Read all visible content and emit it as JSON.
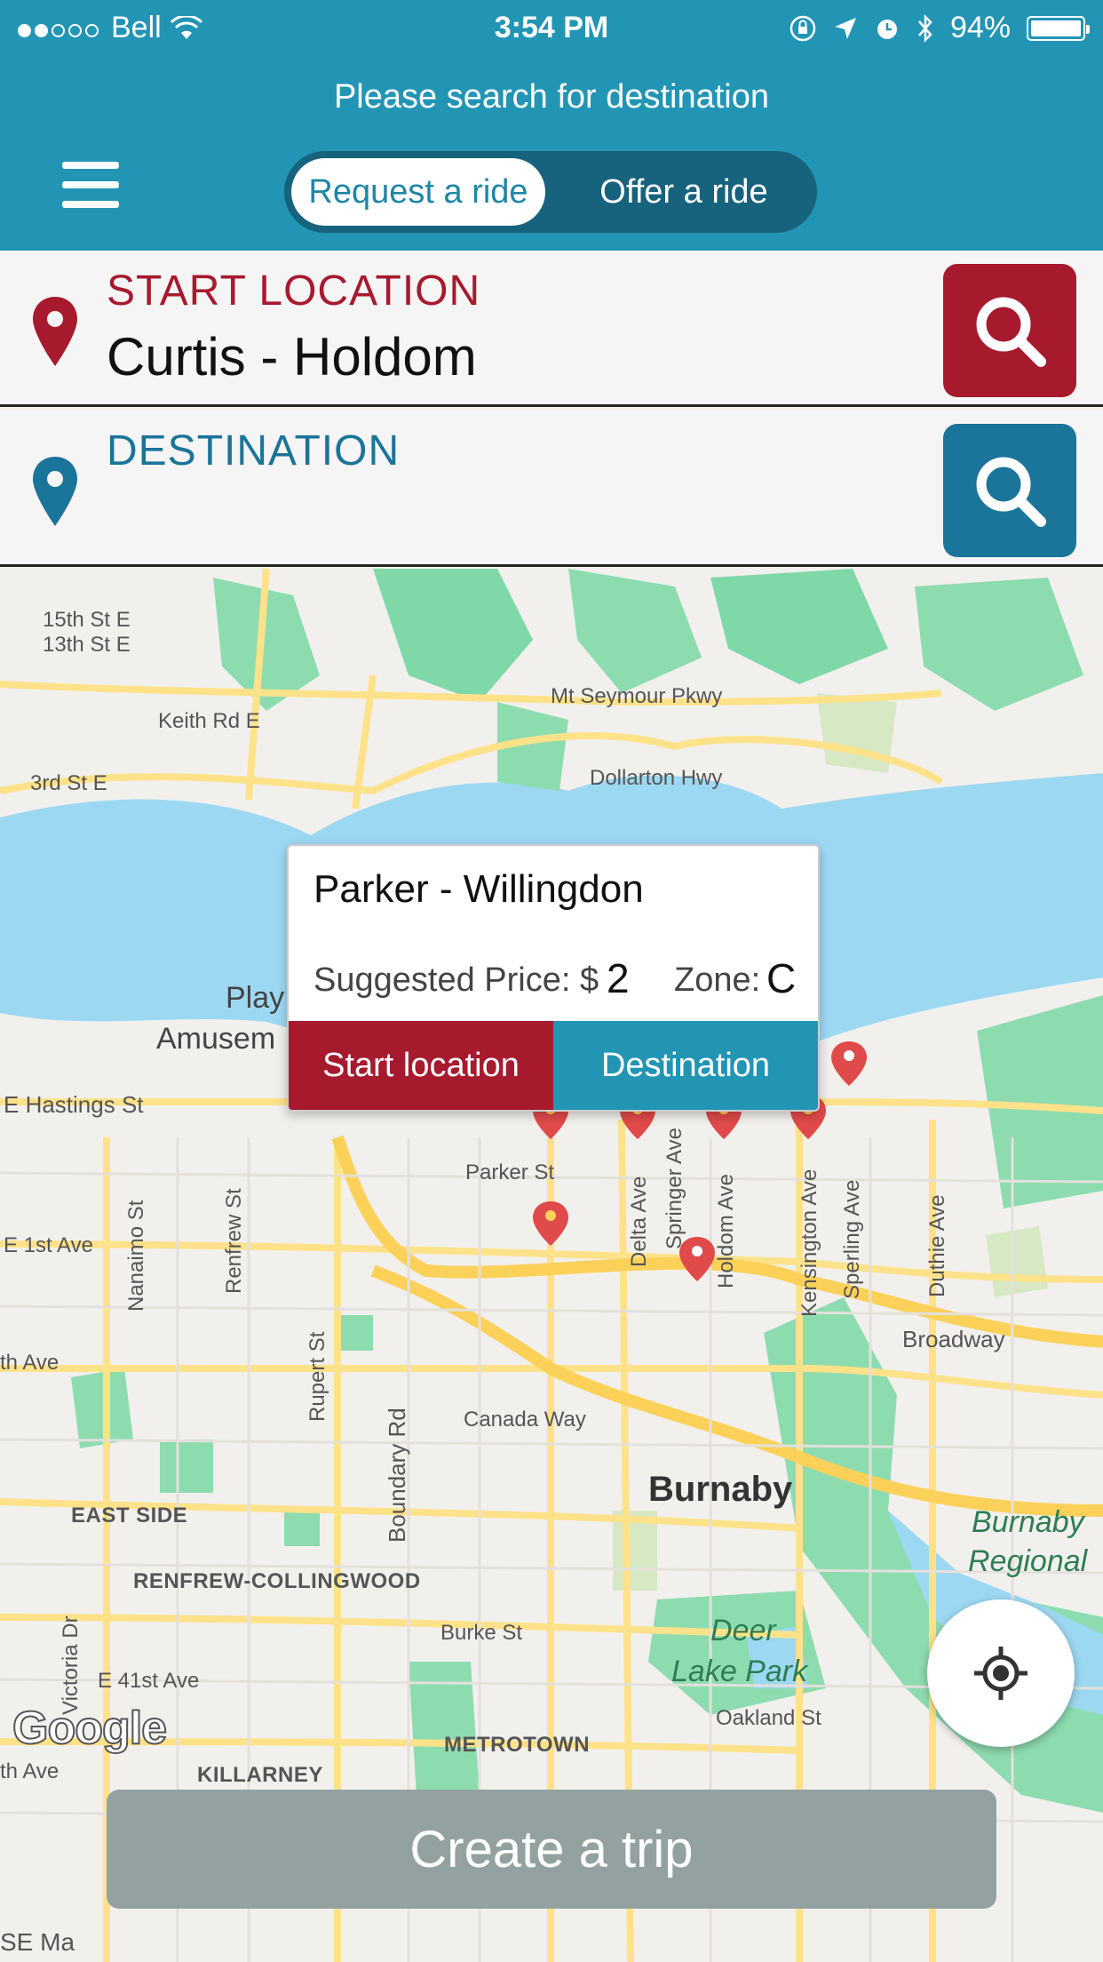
{
  "status_bar": {
    "carrier": "Bell",
    "time": "3:54 PM",
    "battery": "94%",
    "signal_bars_filled": 2,
    "signal_bars_total": 5
  },
  "header": {
    "subtitle": "Please search for destination",
    "segment": {
      "request_label": "Request a ride",
      "offer_label": "Offer a ride",
      "selected": "Request a ride"
    }
  },
  "start": {
    "label": "START LOCATION",
    "value": "Curtis - Holdom"
  },
  "destination": {
    "label": "DESTINATION",
    "value": ""
  },
  "popup": {
    "title": "Parker - Willingdon",
    "price_label": "Suggested Price: $",
    "price_value": "2",
    "zone_label": "Zone:",
    "zone_value": "C",
    "start_button": "Start location",
    "destination_button": "Destination"
  },
  "map": {
    "labels": {
      "st15": "15th St E",
      "st13": "13th St E",
      "keith": "Keith Rd E",
      "st3": "3rd St E",
      "seymour": "Mt Seymour Pkwy",
      "dollarton": "Dollarton Hwy",
      "play": "Play",
      "amusem": "Amusem",
      "hastings": "E Hastings St",
      "parker": "Parker St",
      "first": "E 1st Ave",
      "nanaimo": "Nanaimo St",
      "renfrew": "Renfrew St",
      "rupert": "Rupert St",
      "boundary": "Boundary Rd",
      "delta": "Delta Ave",
      "springer": "Springer Ave",
      "holdom": "Holdom Ave",
      "kensington": "Kensington Ave",
      "sperling": "Sperling Ave",
      "duthie": "Duthie Ave",
      "broadway": "Broadway",
      "thave": "th Ave",
      "canada": "Canada Way",
      "burnaby": "Burnaby",
      "burnaby_regional_1": "Burnaby",
      "burnaby_regional_2": "Regional",
      "eastside": "EAST SIDE",
      "renfrew_coll": "RENFREW-COLLINGWOOD",
      "burke": "Burke St",
      "deer1": "Deer",
      "deer2": "Lake Park",
      "oakland": "Oakland St",
      "victoria": "Victoria Dr",
      "e41": "E 41st Ave",
      "metrotown": "METROTOWN",
      "killarney": "KILLARNEY",
      "thave2": "th Ave",
      "se": "SE Ma"
    },
    "google": "Google"
  },
  "create_trip": "Create a trip",
  "colors": {
    "header": "#2295b5",
    "start_accent": "#a71a2e",
    "dest_accent": "#1b7499",
    "create_button": "#93a2a1"
  }
}
